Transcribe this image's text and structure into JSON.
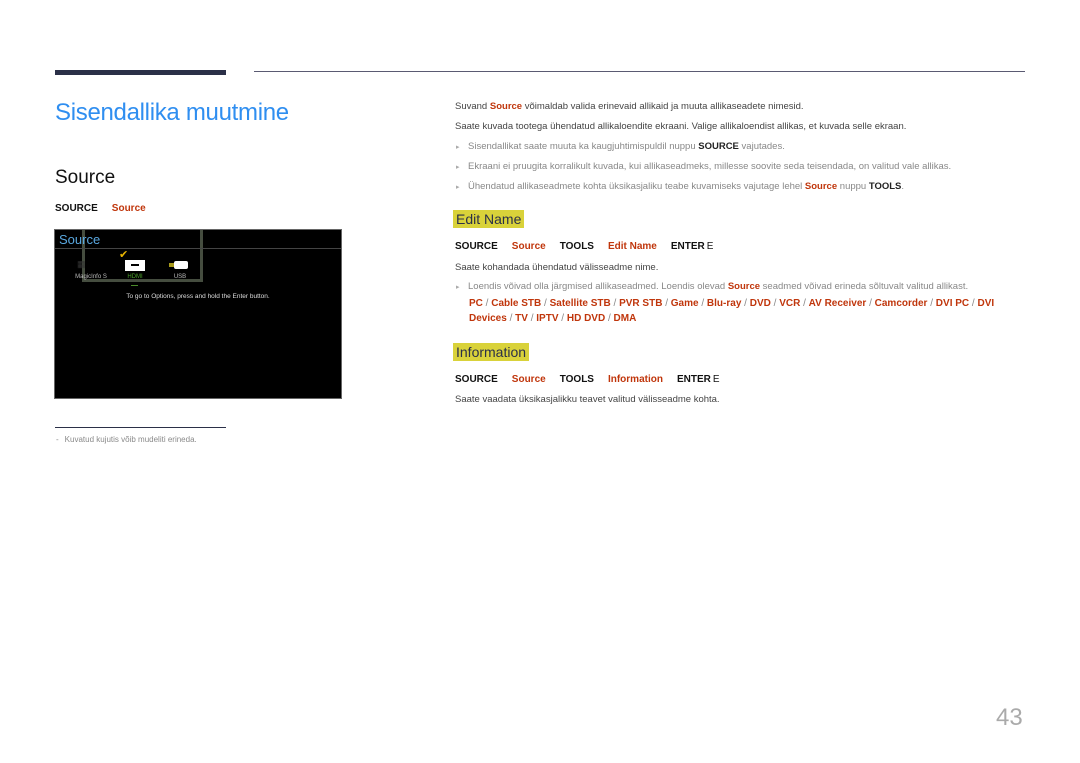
{
  "page": {
    "title": "Sisendallika muutmine",
    "section_title": "Source",
    "page_number": "43"
  },
  "source_path": [
    "SOURCE",
    "Source"
  ],
  "screen": {
    "title": "Source",
    "items": [
      {
        "label": "MagicInfo S",
        "icon": "magicinfo-icon"
      },
      {
        "label": "HDMI",
        "icon": "hdmi-icon",
        "selected": true
      },
      {
        "label": "USB",
        "icon": "usb-icon"
      }
    ],
    "hint": "To go to Options, press and hold the Enter button."
  },
  "note": "Kuvatud kujutis võib mudeliti erineda.",
  "intro": {
    "line1_pre": "Suvand ",
    "line1_bold": "Source",
    "line1_post": " võimaldab valida erinevaid allikaid ja muuta allikaseadete nimesid.",
    "line2": "Saate kuvada tootega ühendatud allikaloendite ekraani. Valige allikaloendist allikas, et kuvada selle ekraan."
  },
  "bullets": [
    {
      "pre": "Sisendallikat saate muuta ka kaugjuhtimispuldil nuppu ",
      "bold": "SOURCE",
      "post": " vajutades."
    },
    {
      "text": "Ekraani ei pruugita korralikult kuvada, kui allikaseadmeks, millesse soovite seda teisendada, on valitud vale allikas."
    },
    {
      "pre": "Ühendatud allikaseadmete kohta üksikasjaliku teabe kuvamiseks vajutage lehel ",
      "red": "Source",
      "mid": " nuppu ",
      "bold": "TOOLS",
      "post": "."
    }
  ],
  "edit_name": {
    "title": "Edit Name",
    "path": [
      "SOURCE",
      "Source",
      "TOOLS",
      "Edit Name",
      "ENTER",
      "E"
    ],
    "desc": "Saate kohandada ühendatud välisseadme nime.",
    "bullet_pre": "Loendis võivad olla järgmised allikaseadmed. Loendis olevad ",
    "bullet_red": "Source",
    "bullet_post": " seadmed võivad erineda sõltuvalt valitud allikast.",
    "devices": [
      "PC",
      "Cable STB",
      "Satellite STB",
      "PVR STB",
      "Game",
      "Blu-ray",
      "DVD",
      "VCR",
      "AV Receiver",
      "Camcorder",
      "DVI PC",
      "DVI Devices",
      "TV",
      "IPTV",
      "HD DVD",
      "DMA"
    ]
  },
  "information": {
    "title": "Information",
    "path": [
      "SOURCE",
      "Source",
      "TOOLS",
      "Information",
      "ENTER",
      "E"
    ],
    "desc": "Saate vaadata üksikasjalikku teavet valitud välisseadme kohta."
  }
}
